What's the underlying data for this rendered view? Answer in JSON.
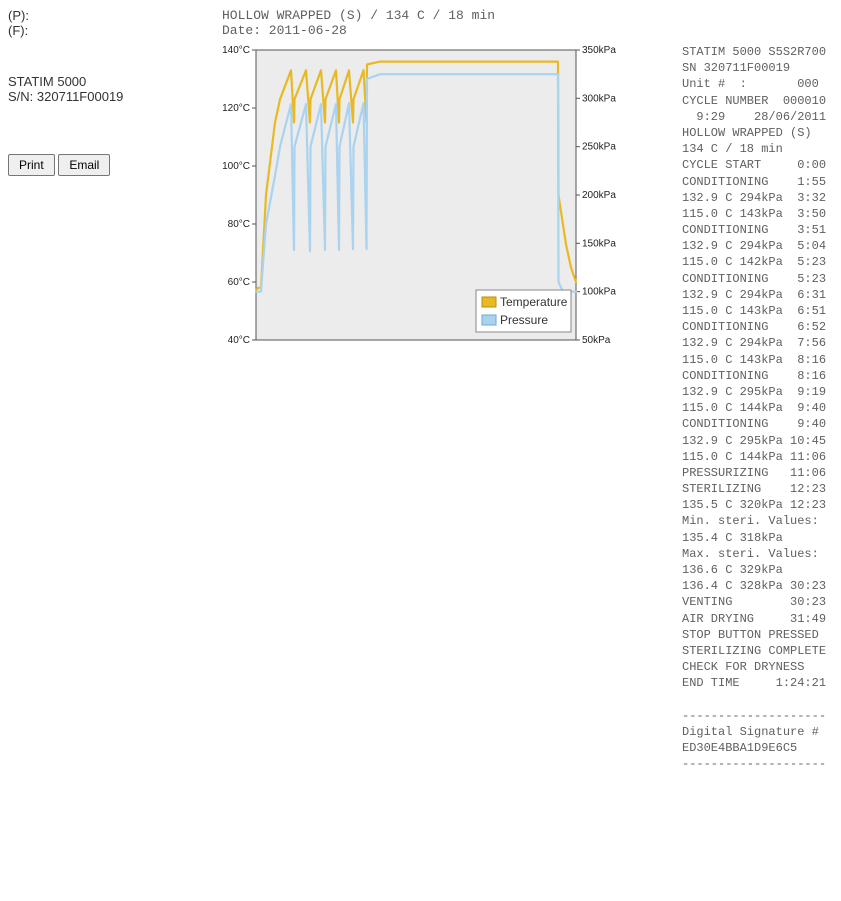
{
  "header": {
    "p_label": "(P):",
    "f_label": "(F):",
    "program_line": "HOLLOW WRAPPED (S) / 134 C / 18 min",
    "date_line": "Date: 2011-06-28"
  },
  "device": {
    "name": "STATIM 5000",
    "sn_label": "S/N: 320711F00019"
  },
  "buttons": {
    "print": "Print",
    "email": "Email"
  },
  "legend": {
    "temperature": "Temperature",
    "pressure": "Pressure"
  },
  "chart_data": {
    "type": "line",
    "x_axis": {
      "range_min": 0,
      "range_max": 32,
      "unit": "min",
      "ticks_shown": false
    },
    "y_left": {
      "label_suffix": "°C",
      "range_min": 40,
      "range_max": 140,
      "ticks": [
        "40°C",
        "60°C",
        "80°C",
        "100°C",
        "120°C",
        "140°C"
      ]
    },
    "y_right": {
      "label_suffix": "kPa",
      "range_min": 50,
      "range_max": 350,
      "ticks": [
        "50kPa",
        "100kPa",
        "150kPa",
        "200kPa",
        "250kPa",
        "300kPa",
        "350kPa"
      ]
    },
    "series": [
      {
        "name": "Temperature",
        "axis": "left",
        "color": "#e8b923",
        "x": [
          0.0,
          0.2,
          0.5,
          1.0,
          1.9,
          2.4,
          3.5,
          3.8,
          3.85,
          5.0,
          5.4,
          5.45,
          6.5,
          6.9,
          6.95,
          8.0,
          8.3,
          8.35,
          9.3,
          9.7,
          9.75,
          10.75,
          11.05,
          11.1,
          12.4,
          30.2,
          30.25,
          31.0,
          31.5,
          31.8,
          32.0
        ],
        "values": [
          57,
          58,
          58,
          90,
          115,
          123,
          133,
          115,
          123,
          133,
          115,
          123,
          133,
          115,
          123,
          133,
          115,
          123,
          133,
          115,
          123,
          133,
          115,
          135,
          136,
          136,
          90,
          73,
          65,
          62,
          60
        ]
      },
      {
        "name": "Pressure",
        "axis": "right",
        "color": "#a9d3ef",
        "x": [
          0.0,
          0.2,
          0.5,
          1.0,
          1.9,
          2.4,
          3.5,
          3.8,
          3.85,
          5.0,
          5.4,
          5.45,
          6.5,
          6.9,
          6.95,
          8.0,
          8.3,
          8.35,
          9.3,
          9.7,
          9.75,
          10.75,
          11.05,
          11.1,
          12.4,
          30.2,
          30.25,
          30.6,
          31.0,
          31.5,
          32.0
        ],
        "values": [
          100,
          100,
          100,
          170,
          220,
          250,
          294,
          143,
          250,
          294,
          142,
          250,
          294,
          143,
          250,
          294,
          143,
          250,
          295,
          144,
          250,
          295,
          144,
          320,
          325,
          325,
          110,
          102,
          100,
          100,
          100
        ]
      }
    ]
  },
  "log_lines": [
    "STATIM 5000 S5S2R700",
    "SN 320711F00019",
    "Unit #  :       000",
    "CYCLE NUMBER  000010",
    "  9:29    28/06/2011",
    "HOLLOW WRAPPED (S)",
    "134 C / 18 min",
    "CYCLE START     0:00",
    "CONDITIONING    1:55",
    "132.9 C 294kPa  3:32",
    "115.0 C 143kPa  3:50",
    "CONDITIONING    3:51",
    "132.9 C 294kPa  5:04",
    "115.0 C 142kPa  5:23",
    "CONDITIONING    5:23",
    "132.9 C 294kPa  6:31",
    "115.0 C 143kPa  6:51",
    "CONDITIONING    6:52",
    "132.9 C 294kPa  7:56",
    "115.0 C 143kPa  8:16",
    "CONDITIONING    8:16",
    "132.9 C 295kPa  9:19",
    "115.0 C 144kPa  9:40",
    "CONDITIONING    9:40",
    "132.9 C 295kPa 10:45",
    "115.0 C 144kPa 11:06",
    "PRESSURIZING   11:06",
    "STERILIZING    12:23",
    "135.5 C 320kPa 12:23",
    "Min. steri. Values:",
    "135.4 C 318kPa",
    "Max. steri. Values:",
    "136.6 C 329kPa",
    "136.4 C 328kPa 30:23",
    "VENTING        30:23",
    "AIR DRYING     31:49",
    "STOP BUTTON PRESSED",
    "STERILIZING COMPLETE",
    "CHECK FOR DRYNESS",
    "END TIME     1:24:21",
    "",
    "--------------------",
    "Digital Signature #",
    "ED30E4BBA1D9E6C5",
    "--------------------"
  ]
}
